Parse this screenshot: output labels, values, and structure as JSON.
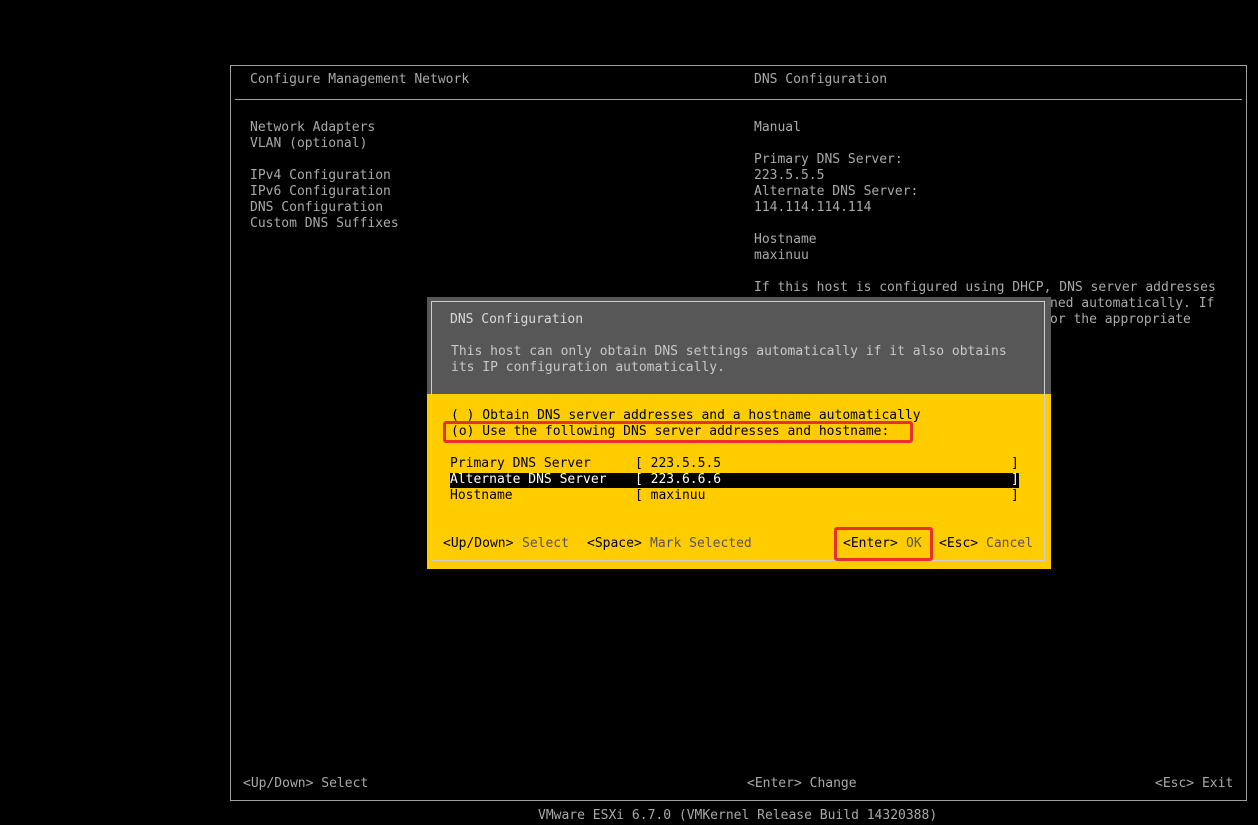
{
  "header": {
    "left_title": "Configure Management Network",
    "right_title": "DNS Configuration"
  },
  "menu": {
    "items": [
      "Network Adapters",
      "VLAN (optional)",
      "IPv4 Configuration",
      "IPv6 Configuration",
      "DNS Configuration",
      "Custom DNS Suffixes"
    ]
  },
  "info": {
    "mode": "Manual",
    "primary_label": "Primary DNS Server:",
    "primary_value": "223.5.5.5",
    "alternate_label": "Alternate DNS Server:",
    "alternate_value": "114.114.114.114",
    "hostname_label": "Hostname",
    "hostname_value": "maxinuu",
    "note_line1": "If this host is configured using DHCP, DNS server addresses",
    "note_line2": "ned automatically. If",
    "note_line3": "or the appropriate"
  },
  "dialog": {
    "title": "DNS Configuration",
    "desc_line1": "This host can only obtain DNS settings automatically if it also obtains",
    "desc_line2": "its IP configuration automatically.",
    "option_auto": "( ) Obtain DNS server addresses and a hostname automatically",
    "option_manual": "(o) Use the following DNS server addresses and hostname:",
    "fields": [
      {
        "label": "Primary DNS Server",
        "value": "[ 223.5.5.5",
        "close": "]"
      },
      {
        "label": "Alternate DNS Server",
        "value": "[ 223.6.6.6",
        "close": "]"
      },
      {
        "label": "Hostname",
        "value": "[ maxinuu",
        "close": "]"
      }
    ],
    "footer": {
      "updown_key": "<Up/Down>",
      "updown_action": "Select",
      "space_key": "<Space>",
      "space_action": "Mark Selected",
      "enter_key": "<Enter>",
      "enter_action": "OK",
      "esc_key": "<Esc>",
      "esc_action": "Cancel"
    }
  },
  "status": {
    "left": "<Up/Down> Select",
    "center": "<Enter> Change",
    "right": "<Esc> Exit"
  },
  "footer": {
    "version": "VMware ESXi 6.7.0 (VMKernel Release Build 14320388)"
  },
  "colors": {
    "dialog_bg": "#ffcc00",
    "dialog_header_bg": "#575757",
    "highlight": "#e8312f"
  }
}
